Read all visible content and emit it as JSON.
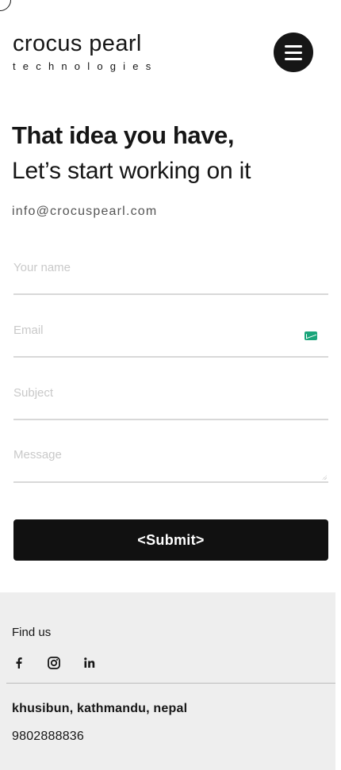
{
  "brand": {
    "name": "crocus pearl",
    "tagline": "technologies"
  },
  "header": {
    "menu_icon": "hamburger-menu-icon"
  },
  "hero": {
    "headline": "That idea you have,",
    "subheadline": "Let’s start working on it",
    "email": "info@crocuspearl.com"
  },
  "form": {
    "name_placeholder": "Your name",
    "email_placeholder": "Email",
    "subject_placeholder": "Subject",
    "message_placeholder": "Message",
    "submit_label": "<Submit>"
  },
  "footer": {
    "find_us": "Find us",
    "social": [
      {
        "icon": "facebook-icon"
      },
      {
        "icon": "instagram-icon"
      },
      {
        "icon": "linkedin-icon"
      }
    ],
    "address": "khusibun, kathmandu, nepal",
    "phone": "9802888836"
  },
  "colors": {
    "primary": "#161616",
    "button": "#111111",
    "footer_bg": "#eeeeee",
    "field_border": "#d8d8d8",
    "placeholder": "#c9c9c9",
    "email_badge": "#1aa57a"
  }
}
